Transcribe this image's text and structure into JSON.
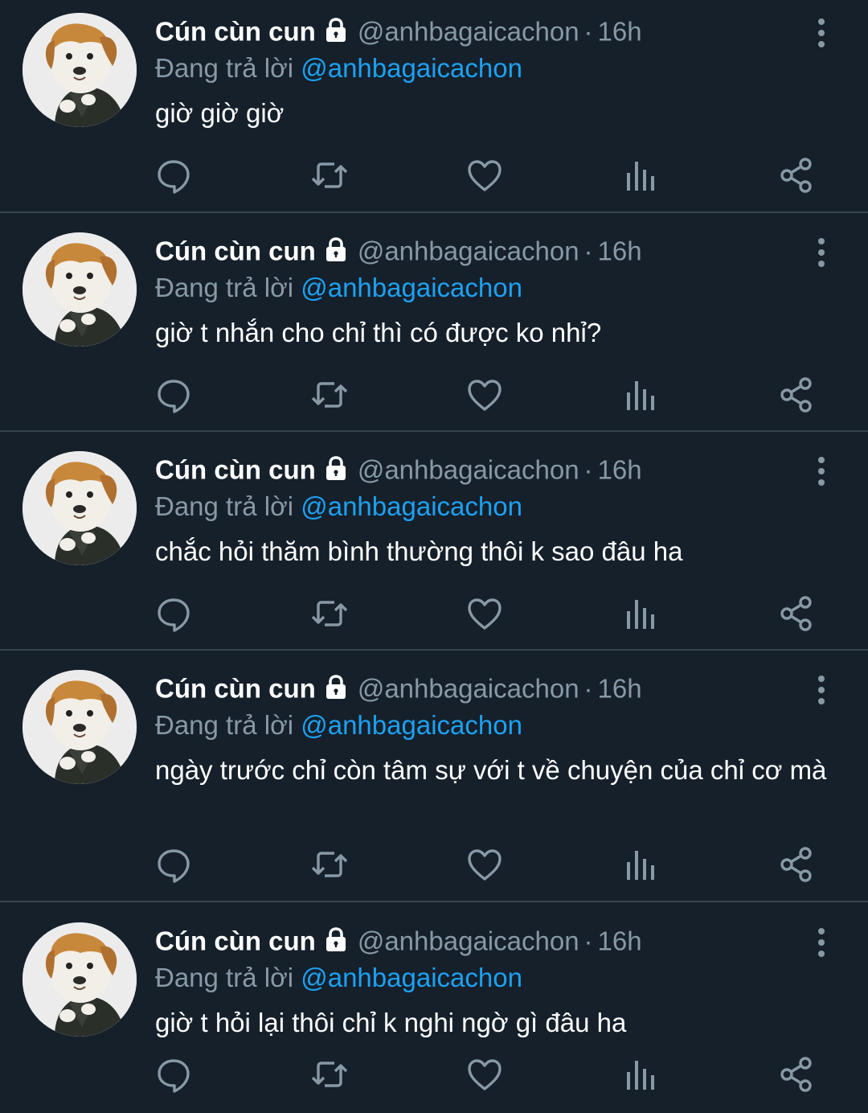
{
  "tweets": [
    {
      "name": "Cún cùn cun",
      "handle": "@anhbagaicachon",
      "dot": "·",
      "time": "16h",
      "reply_prefix": "Đang trả lời",
      "reply_to": "@anhbagaicachon",
      "text": "giờ giờ giờ"
    },
    {
      "name": "Cún cùn cun",
      "handle": "@anhbagaicachon",
      "dot": "·",
      "time": "16h",
      "reply_prefix": "Đang trả lời",
      "reply_to": "@anhbagaicachon",
      "text": "giờ t nhắn cho chỉ thì có được ko nhỉ?"
    },
    {
      "name": "Cún cùn cun",
      "handle": "@anhbagaicachon",
      "dot": "·",
      "time": "16h",
      "reply_prefix": "Đang trả lời",
      "reply_to": "@anhbagaicachon",
      "text": "chắc hỏi thăm bình thường thôi k sao đâu ha"
    },
    {
      "name": "Cún cùn cun",
      "handle": "@anhbagaicachon",
      "dot": "·",
      "time": "16h",
      "reply_prefix": "Đang trả lời",
      "reply_to": "@anhbagaicachon",
      "text": "ngày trước chỉ còn tâm sự với t về chuyện của chỉ cơ mà"
    },
    {
      "name": "Cún cùn cun",
      "handle": "@anhbagaicachon",
      "dot": "·",
      "time": "16h",
      "reply_prefix": "Đang trả lời",
      "reply_to": "@anhbagaicachon",
      "text": "giờ t hỏi lại thôi chỉ k nghi ngờ gì đâu ha"
    }
  ],
  "icons": {
    "avatar": "dog-in-suit-avatar",
    "lock": "lock-icon",
    "more": "more-vertical-icon",
    "actions": [
      "reply-icon",
      "retweet-icon",
      "like-icon",
      "analytics-icon",
      "share-icon"
    ]
  },
  "colors": {
    "background": "#15202b",
    "divider": "#38444d",
    "text": "#ffffff",
    "secondary_text": "#8899a6",
    "mention": "#1da1f2"
  }
}
